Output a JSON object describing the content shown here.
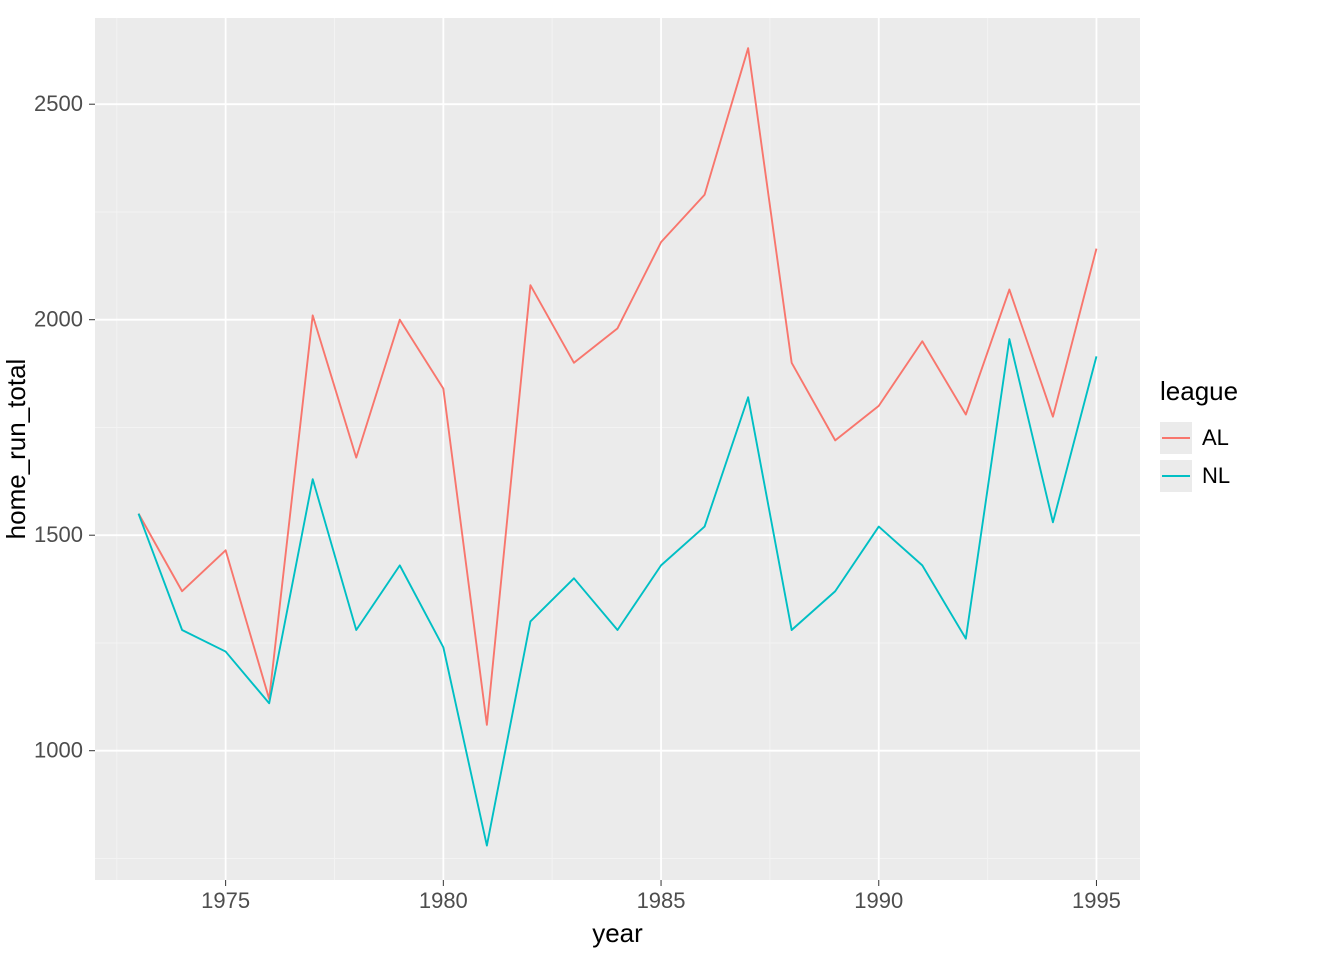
{
  "chart_data": {
    "type": "line",
    "xlabel": "year",
    "ylabel": "home_run_total",
    "legend_title": "league",
    "xlim": [
      1972,
      1996
    ],
    "ylim": [
      700,
      2700
    ],
    "x_ticks": [
      1975,
      1980,
      1985,
      1990,
      1995
    ],
    "y_ticks": [
      1000,
      1500,
      2000,
      2500
    ],
    "x": [
      1973,
      1974,
      1975,
      1976,
      1977,
      1978,
      1979,
      1980,
      1981,
      1982,
      1983,
      1984,
      1985,
      1986,
      1987,
      1988,
      1989,
      1990,
      1991,
      1992,
      1993,
      1994,
      1995
    ],
    "series": [
      {
        "name": "AL",
        "color": "#F8766D",
        "values": [
          1550,
          1370,
          1465,
          1120,
          2010,
          1680,
          2000,
          1840,
          1060,
          2080,
          1900,
          1980,
          2180,
          2290,
          2630,
          1900,
          1720,
          1800,
          1950,
          1780,
          2070,
          1775,
          2165
        ]
      },
      {
        "name": "NL",
        "color": "#00BFC4",
        "values": [
          1550,
          1280,
          1230,
          1110,
          1630,
          1280,
          1430,
          1240,
          780,
          1300,
          1400,
          1280,
          1430,
          1520,
          1820,
          1280,
          1370,
          1520,
          1430,
          1260,
          1955,
          1530,
          1915
        ]
      }
    ]
  }
}
